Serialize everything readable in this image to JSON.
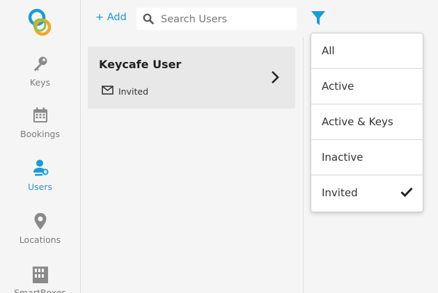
{
  "app": {
    "accent_color": "#1a9bd7",
    "logo_icon": "keycafe-logo"
  },
  "sidebar": {
    "items": [
      {
        "label": "Keys",
        "icon": "key-icon",
        "active": false
      },
      {
        "label": "Bookings",
        "icon": "calendar-icon",
        "active": false
      },
      {
        "label": "Users",
        "icon": "users-icon",
        "active": true
      },
      {
        "label": "Locations",
        "icon": "map-pin-icon",
        "active": false
      },
      {
        "label": "SmartBoxes",
        "icon": "smartbox-icon",
        "active": false
      }
    ]
  },
  "header": {
    "add_label": "+ Add",
    "search_placeholder": "Search Users",
    "search_value": "",
    "filter_icon": "filter-icon"
  },
  "user_list": [
    {
      "name": "Keycafe User",
      "status": "Invited",
      "status_icon": "mail-icon"
    }
  ],
  "filter_menu": {
    "options": [
      "All",
      "Active",
      "Active & Keys",
      "Inactive",
      "Invited"
    ],
    "selected": "Invited"
  }
}
